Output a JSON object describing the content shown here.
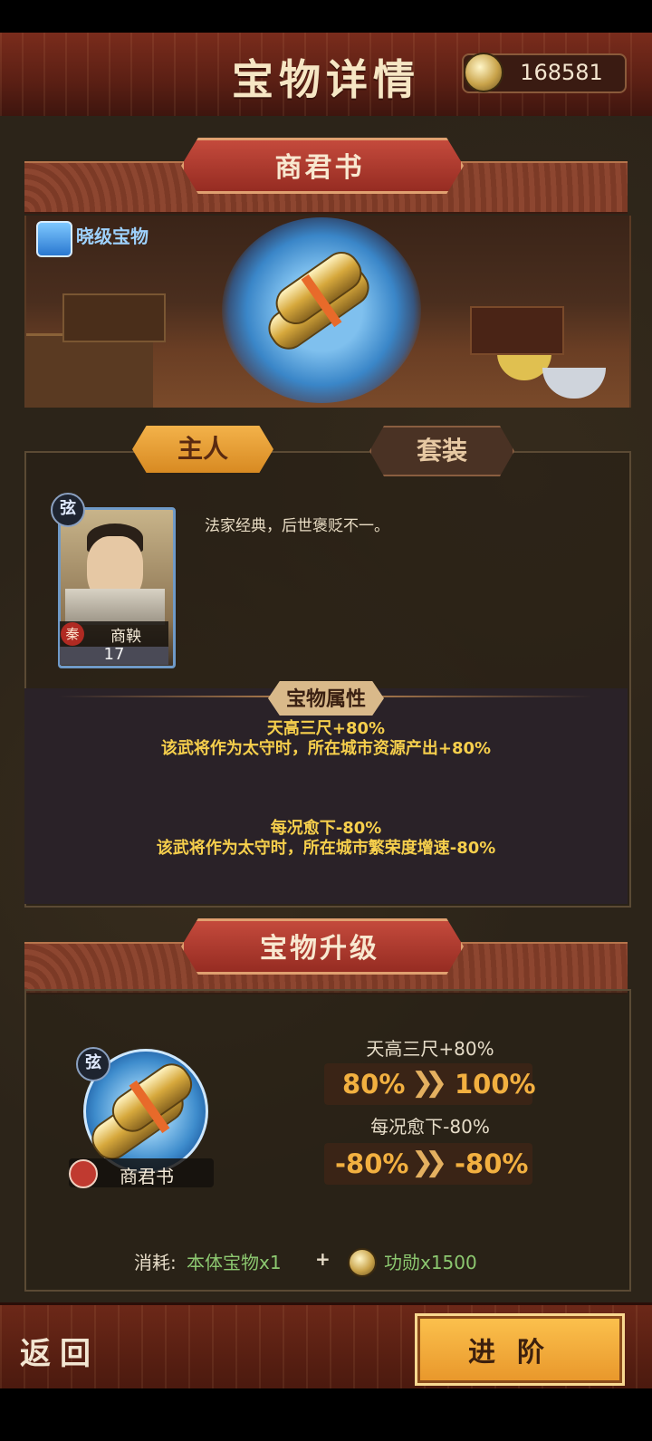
{
  "header": {
    "title": "宝物详情",
    "coins": "168581",
    "coin_icon": "coin-icon"
  },
  "treasure": {
    "name": "商君书",
    "rank_label": "晓级宝物"
  },
  "tabs": {
    "owner": "主人",
    "set": "套装"
  },
  "owner": {
    "state": "秦",
    "name": "商鞅",
    "level": "17",
    "rank_glyph": "弦",
    "description": "法家经典，后世褒贬不一。"
  },
  "attributes": {
    "title": "宝物属性",
    "items": [
      {
        "name": "天高三尺+80%",
        "effect": "该武将作为太守时，所在城市资源产出+80%"
      },
      {
        "name": "每况愈下-80%",
        "effect": "该武将作为太守时，所在城市繁荣度增速-80%"
      }
    ]
  },
  "upgrade": {
    "title": "宝物升级",
    "item_name": "商君书",
    "rank_glyph": "弦",
    "stats": [
      {
        "name": "天高三尺+80%",
        "from": "80%",
        "to": "100%"
      },
      {
        "name": "每况愈下-80%",
        "from": "-80%",
        "to": "-80%"
      }
    ],
    "cost_label": "消耗:",
    "cost_item": "本体宝物x1",
    "plus": "+",
    "cost_merit": "功勋x1500"
  },
  "footer": {
    "back": "返回",
    "advance": "进阶"
  },
  "colors": {
    "accent": "#e8962a",
    "stat_value": "#f2b040",
    "attr_text": "#f6cf4c",
    "cost_green": "#8cc870"
  }
}
